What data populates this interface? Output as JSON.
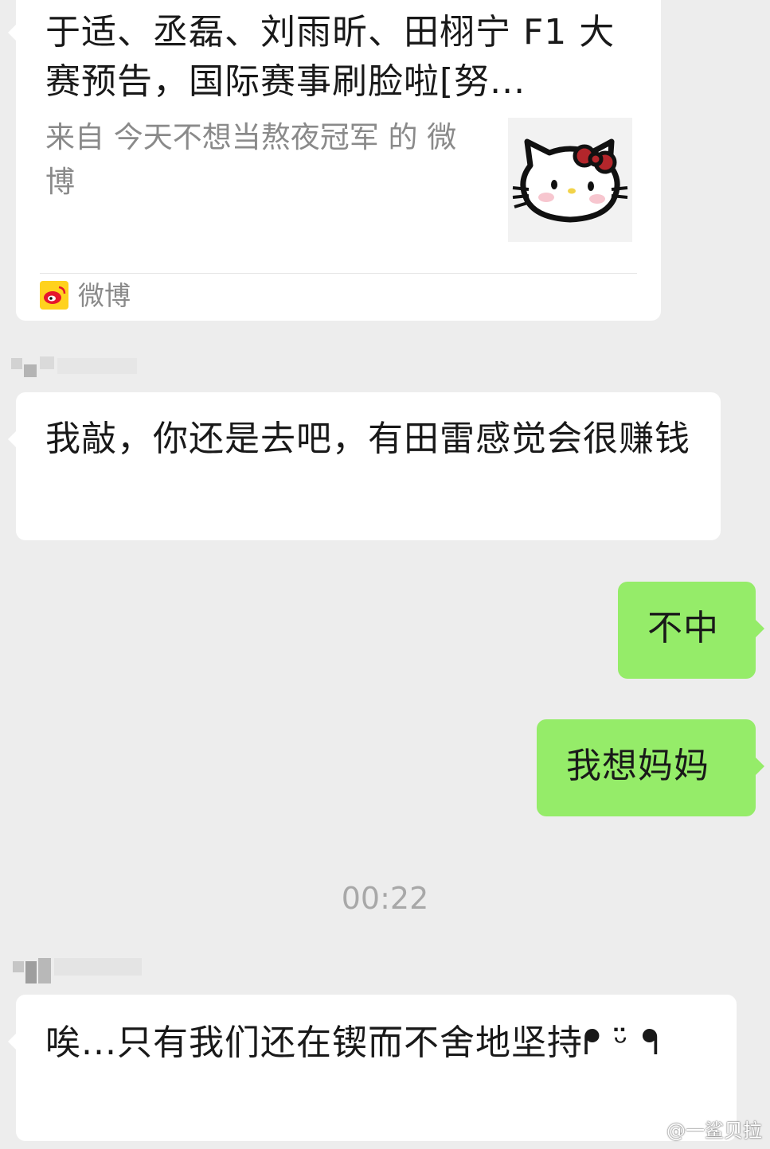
{
  "shared_card": {
    "title": "于适、丞磊、刘雨昕、田栩宁 F1 大赛预告，国际赛事刷脸啦[努...",
    "source": "来自 今天不想当熬夜冠军 的 微博",
    "app_label": "微博",
    "thumbnail_icon": "hello-kitty-icon",
    "app_icon": "weibo-icon"
  },
  "messages": [
    {
      "text": "我敲，你还是去吧，有田雷感觉会很赚钱"
    },
    {
      "text": "不中"
    },
    {
      "text": "我想妈妈"
    },
    {
      "text": "唉...只有我们还在锲而不舍地坚持ᖰ ᵕ̈ ᖳ"
    }
  ],
  "timestamp": "00:22",
  "watermark": {
    "text": "@一鲨贝拉",
    "icon": "weibo-icon"
  },
  "colors": {
    "background": "#ededed",
    "incoming_bubble": "#ffffff",
    "outgoing_bubble": "#95ec69",
    "secondary_text": "#8a8a8a"
  }
}
